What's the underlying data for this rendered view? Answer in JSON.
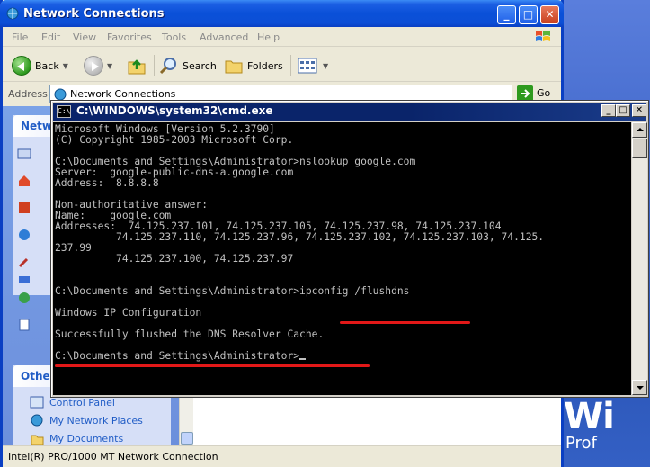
{
  "explorer": {
    "title": "Network Connections",
    "menu": [
      "File",
      "Edit",
      "View",
      "Favorites",
      "Tools",
      "Advanced",
      "Help"
    ],
    "toolbar": {
      "back": "Back",
      "search": "Search",
      "folders": "Folders"
    },
    "address": {
      "label": "Address",
      "value": "Network Connections",
      "go": "Go"
    },
    "taskpane": {
      "card1_head": "Netw",
      "card2_head": "Othe",
      "links": [
        "Control Panel",
        "My Network Places",
        "My Documents"
      ]
    },
    "status": "Intel(R) PRO/1000 MT Network Connection"
  },
  "cmd": {
    "title": "C:\\WINDOWS\\system32\\cmd.exe",
    "icon_text": "C:\\",
    "lines": [
      "Microsoft Windows [Version 5.2.3790]",
      "(C) Copyright 1985-2003 Microsoft Corp.",
      "",
      "C:\\Documents and Settings\\Administrator>nslookup google.com",
      "Server:  google-public-dns-a.google.com",
      "Address:  8.8.8.8",
      "",
      "Non-authoritative answer:",
      "Name:    google.com",
      "Addresses:  74.125.237.101, 74.125.237.105, 74.125.237.98, 74.125.237.104",
      "          74.125.237.110, 74.125.237.96, 74.125.237.102, 74.125.237.103, 74.125.",
      "237.99",
      "          74.125.237.100, 74.125.237.97",
      "",
      "",
      "C:\\Documents and Settings\\Administrator>ipconfig /flushdns",
      "",
      "Windows IP Configuration",
      "",
      "Successfully flushed the DNS Resolver Cache.",
      "",
      "C:\\Documents and Settings\\Administrator>"
    ]
  },
  "desktop": {
    "brand_big": "Wi",
    "brand_small": "Prof"
  }
}
